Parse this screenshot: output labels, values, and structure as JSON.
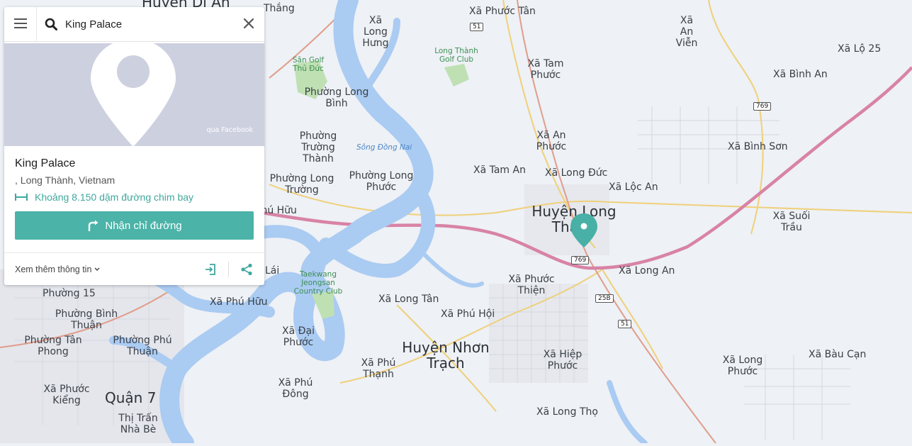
{
  "search": {
    "value": "King Palace"
  },
  "place": {
    "photo_credit": "qua Facebook",
    "name": "King Palace",
    "address": ", Long Thành, Vietnam",
    "distance": "Khoảng 8.150 dặm đường chim bay",
    "directions_label": "Nhận chỉ đường",
    "more_info_label": "Xem thêm thông tin"
  },
  "colors": {
    "accent": "#4bb3a8",
    "highway": "#d883a6",
    "river": "#aacbf2",
    "park": "#bfe0b3",
    "land": "#eef1f5"
  },
  "icons": [
    "menu-icon",
    "search-icon",
    "close-icon",
    "ruler-icon",
    "directions-icon",
    "save-to-device-icon",
    "share-icon",
    "map-pin-icon"
  ],
  "map": {
    "labels": [
      {
        "text": "Huyện Dĩ An",
        "kind": "big"
      },
      {
        "text": "Thắng"
      },
      {
        "text": "Xã Long Hưng"
      },
      {
        "text": "Xã Phước Tân"
      },
      {
        "text": "Xã An Viễn"
      },
      {
        "text": "Xã Lộ 25"
      },
      {
        "text": "Sân Golf Thủ Đức",
        "kind": "green"
      },
      {
        "text": "Long Thành Golf Club",
        "kind": "green"
      },
      {
        "text": "Xã Tam Phước"
      },
      {
        "text": "Xã Bình An"
      },
      {
        "text": "Phường Long Bình"
      },
      {
        "text": "Phường Trường Thành"
      },
      {
        "text": "Sông Đồng Nai",
        "kind": "river"
      },
      {
        "text": "Xã An Phước"
      },
      {
        "text": "Xã Bình Sơn"
      },
      {
        "text": "Xã Tam An"
      },
      {
        "text": "Xã Long Đức"
      },
      {
        "text": "Phường Long Trường"
      },
      {
        "text": "Phường Long Phước"
      },
      {
        "text": "Xã Lộc An"
      },
      {
        "text": "Huyện Long Thành",
        "kind": "big"
      },
      {
        "text": "Xã Suối Trầu"
      },
      {
        "text": "Phú Hữu"
      },
      {
        "text": "Xã Long An"
      },
      {
        "text": "Lái"
      },
      {
        "text": "Xã Phước Thiện"
      },
      {
        "text": "Taekwang Jeongsan Country Club",
        "kind": "green"
      },
      {
        "text": "Phường 15"
      },
      {
        "text": "Xã Phú Hữu"
      },
      {
        "text": "Xã Long Tân"
      },
      {
        "text": "Phường Bình Thuận"
      },
      {
        "text": "Xã Phú Hội"
      },
      {
        "text": "Phường Tân Phong"
      },
      {
        "text": "Phường Phú Thuận"
      },
      {
        "text": "Xã Đại Phước"
      },
      {
        "text": "Huyện Nhơn Trạch",
        "kind": "big"
      },
      {
        "text": "Xã Hiệp Phước"
      },
      {
        "text": "Xã Long Phước"
      },
      {
        "text": "Xã Bàu Cạn"
      },
      {
        "text": "Xã Phú Thạnh"
      },
      {
        "text": "Xã Phú Đông"
      },
      {
        "text": "Xã Phước Kiểng"
      },
      {
        "text": "Quận 7",
        "kind": "big"
      },
      {
        "text": "Thị Trấn Nhà Bè"
      },
      {
        "text": "Xã Long Thọ"
      }
    ],
    "shields": [
      "51",
      "769",
      "769",
      "25B",
      "51"
    ]
  }
}
